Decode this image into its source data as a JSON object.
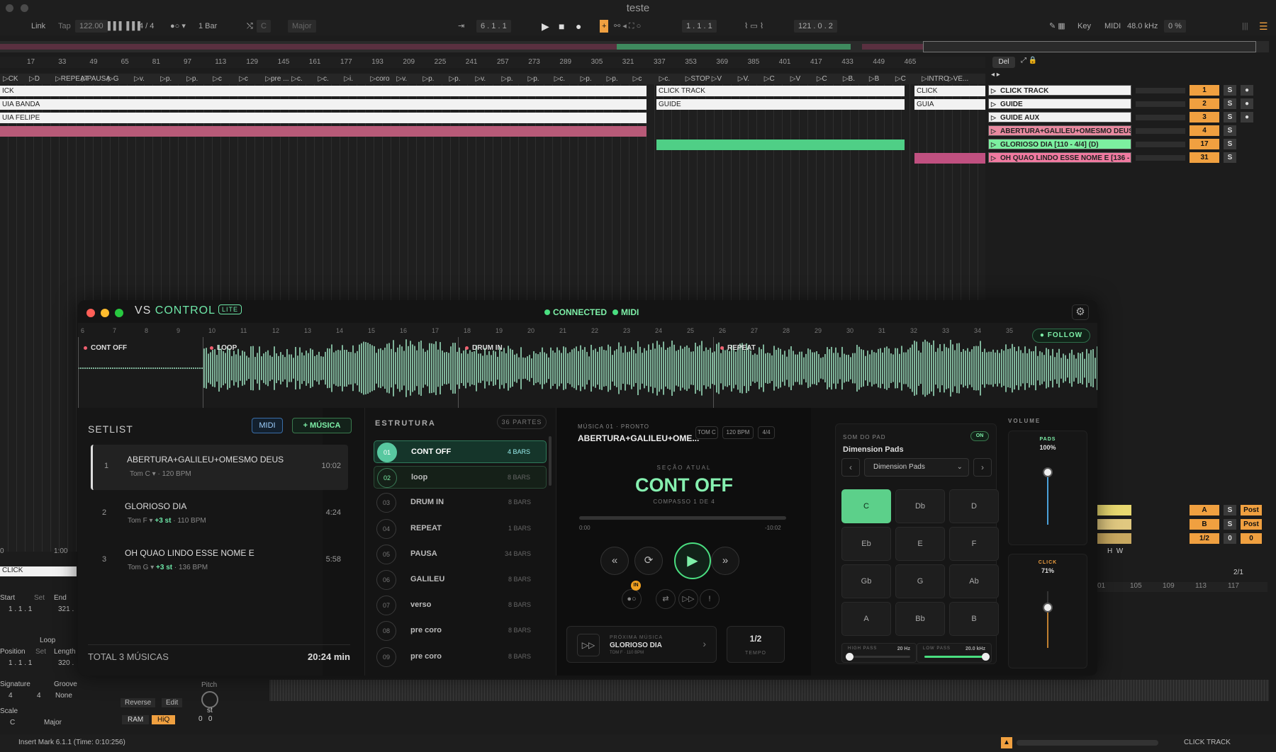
{
  "daw": {
    "title": "teste",
    "toolbar": {
      "link": "Link",
      "tap": "Tap",
      "bpm": "122.00",
      "meter": "4 / 4",
      "quant": "1 Bar",
      "key": "C",
      "scale": "Major",
      "position": "6 . 1 . 1",
      "loop_start": "1 . 1 . 1",
      "loop_len": "121 . 0 . 2",
      "key_btn": "Key",
      "midi_btn": "MIDI",
      "sr": "48.0 kHz",
      "cpu": "0 %"
    },
    "ruler": [
      "17",
      "33",
      "49",
      "65",
      "81",
      "97",
      "113",
      "129",
      "145",
      "161",
      "177",
      "193",
      "209",
      "225",
      "241",
      "257",
      "273",
      "289",
      "305",
      "321",
      "337",
      "353",
      "369",
      "385",
      "401",
      "417",
      "433",
      "449",
      "465"
    ],
    "locators": [
      "CK",
      "D",
      "REPEAT",
      "PAUSA",
      "G",
      "v.",
      "p.",
      "p.",
      "c",
      "c",
      "pre ...",
      "c.",
      "c.",
      "i.",
      "coro",
      "v.",
      "p.",
      "p.",
      "v.",
      "p.",
      "p.",
      "c.",
      "p.",
      "p.",
      "c",
      "c.",
      "STOP",
      "V",
      "V.",
      "C",
      "V",
      "C",
      "B.",
      "B",
      "C",
      "INTRO",
      "VE..."
    ],
    "clip_labels": {
      "click": "ICK",
      "banda": "UIA BANDA",
      "felipe": "UIA FELIPE",
      "click2": "CLICK TRACK",
      "guide2": "GUIDE",
      "click3": "CLICK",
      "guia3": "GUIA"
    },
    "del": "Del",
    "tracks": [
      {
        "name": "CLICK TRACK",
        "num": "1",
        "solo": "S",
        "color": "#f2f2f2"
      },
      {
        "name": "GUIDE",
        "num": "2",
        "solo": "S",
        "color": "#f2f2f2"
      },
      {
        "name": "GUIDE AUX",
        "num": "3",
        "solo": "S",
        "color": "#f2f2f2"
      },
      {
        "name": "ABERTURA+GALILEU+OMESMO DEUS",
        "num": "4",
        "solo": "S",
        "color": "#e88aa0"
      },
      {
        "name": "GLORIOSO DIA [110 - 4/4] (D)",
        "num": "17",
        "solo": "S",
        "color": "#7cf0a0"
      },
      {
        "name": "OH QUAO LINDO ESSE NOME E [136 -",
        "num": "31",
        "solo": "S",
        "color": "#f07aa0"
      }
    ],
    "returns": [
      {
        "num": "A",
        "s": "S",
        "post": "Post"
      },
      {
        "num": "B",
        "s": "S",
        "post": "Post"
      },
      {
        "num": "1/2",
        "s": "0",
        "post": "0"
      }
    ],
    "hw": [
      "H",
      "W"
    ],
    "bottom_ruler": [
      "01",
      "105",
      "109",
      "113",
      "117"
    ],
    "page": "2/1",
    "left_panel": {
      "clip": "CLICK",
      "start": "Start",
      "set": "Set",
      "end": "End",
      "start_v": "1 . 1 . 1",
      "end_v": "321 .",
      "loop": "Loop",
      "position": "Position",
      "length": "Length",
      "pos_v": "1 . 1 . 1",
      "len_v": "320 .",
      "signature": "Signature",
      "groove": "Groove",
      "sig_n": "4",
      "sig_d": "4",
      "groove_v": "None",
      "scale": "Scale",
      "scale_key": "C",
      "scale_mode": "Major",
      "pitch": "Pitch",
      "st": "st",
      "reverse": "Reverse",
      "edit": "Edit",
      "ram": "RAM",
      "hiq": "HiQ",
      "p0": "0",
      "p1": "0",
      "time_a": "0",
      "time_b": "1:00"
    },
    "status": "Insert Mark 6.1.1 (Time: 0:10:256)",
    "status_track": "CLICK TRACK"
  },
  "vs": {
    "brand_a": "VS",
    "brand_b": "CONTROL",
    "lite": "LITE",
    "connected": "CONNECTED",
    "midi": "MIDI",
    "follow": "FOLLOW",
    "wave_ruler": [
      "6",
      "7",
      "8",
      "9",
      "10",
      "11",
      "12",
      "13",
      "14",
      "15",
      "16",
      "17",
      "18",
      "19",
      "20",
      "21",
      "22",
      "23",
      "24",
      "25",
      "26",
      "27",
      "28",
      "29",
      "30",
      "31",
      "32",
      "33",
      "34",
      "35"
    ],
    "markers": [
      "CONT OFF",
      "LOOP",
      "DRUM IN",
      "REPEAT"
    ],
    "setlist": {
      "title": "SETLIST",
      "midi_btn": "MIDI",
      "add_btn": "+ MÚSICA",
      "songs": [
        {
          "num": "1",
          "name": "ABERTURA+GALILEU+OMESMO DEUS",
          "tom": "Tom C",
          "shift": "",
          "bpm": "· 120 BPM",
          "dur": "10:02"
        },
        {
          "num": "2",
          "name": "GLORIOSO DIA",
          "tom": "Tom F",
          "shift": "+3 st",
          "bpm": "· 110 BPM",
          "dur": "4:24"
        },
        {
          "num": "3",
          "name": "OH QUAO LINDO ESSE NOME E",
          "tom": "Tom G",
          "shift": "+3 st",
          "bpm": "· 136 BPM",
          "dur": "5:58"
        }
      ],
      "total_label": "TOTAL 3 MÚSICAS",
      "total_time": "20:24 min"
    },
    "estrutura": {
      "title": "ESTRUTURA",
      "count": "36 PARTES",
      "parts": [
        {
          "n": "01",
          "label": "CONT OFF",
          "bars": "4 BARS"
        },
        {
          "n": "02",
          "label": "loop",
          "bars": "8 BARS"
        },
        {
          "n": "03",
          "label": "DRUM IN",
          "bars": "8 BARS"
        },
        {
          "n": "04",
          "label": "REPEAT",
          "bars": "1 BARS"
        },
        {
          "n": "05",
          "label": "PAUSA",
          "bars": "34 BARS"
        },
        {
          "n": "06",
          "label": "GALILEU",
          "bars": "8 BARS"
        },
        {
          "n": "07",
          "label": "verso",
          "bars": "8 BARS"
        },
        {
          "n": "08",
          "label": "pre coro",
          "bars": "8 BARS"
        },
        {
          "n": "09",
          "label": "pre coro",
          "bars": "8 BARS"
        }
      ]
    },
    "player": {
      "sub": "MÚSICA 01 · PRONTO",
      "song": "ABERTURA+GALILEU+OME...",
      "chips": [
        "TOM C",
        "120 BPM",
        "4/4"
      ],
      "section_label": "SEÇÃO ATUAL",
      "section": "CONT OFF",
      "compasso": "COMPASSO 1 DE 4",
      "progress": 0.0,
      "t_start": "0:00",
      "t_end": "-10:02",
      "in_badge": "IN",
      "next_label": "PRÓXIMA MÚSICA",
      "next_song": "GLORIOSO DIA",
      "next_meta": "TOM F · 110 BPM",
      "tempo": "1/2",
      "tempo_label": "TEMPO"
    },
    "pad": {
      "label": "SOM DO PAD",
      "on": "ON",
      "name": "Dimension Pads",
      "select": "Dimension Pads",
      "keys": [
        "C",
        "Db",
        "D",
        "Eb",
        "E",
        "F",
        "Gb",
        "G",
        "Ab",
        "A",
        "Bb",
        "B"
      ],
      "active_key": "C",
      "hp_label": "HIGH PASS",
      "hp_value": "20 Hz",
      "hp_level": 0.0,
      "lp_label": "LOW PASS",
      "lp_value": "20.0 kHz",
      "lp_level": 1.0
    },
    "volume": {
      "label": "VOLUME",
      "pads_label": "PADS",
      "pads_value": "100%",
      "pads_level": 1.0,
      "click_label": "CLICK",
      "click_value": "71%",
      "click_level": 0.71
    },
    "colors": {
      "accent": "#6ee7a8",
      "wave": "#7fb49a",
      "marker": "#f06070",
      "pad_on": "#5cd08a"
    }
  }
}
